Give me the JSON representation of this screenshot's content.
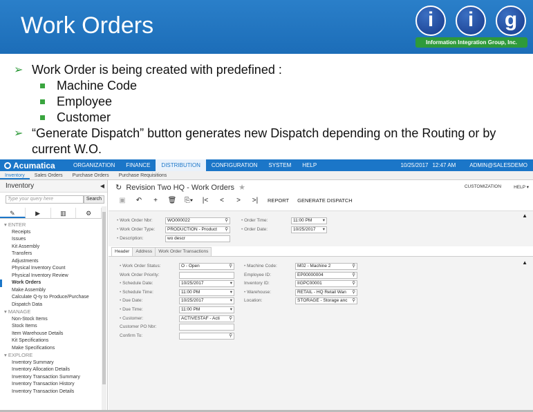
{
  "slide": {
    "title": "Work Orders",
    "logo": {
      "letters": [
        "i",
        "i",
        "g"
      ],
      "caption": "Information Integration Group, Inc."
    },
    "bullets": [
      {
        "level": 1,
        "text": "Work Order is being created with predefined :"
      },
      {
        "level": 2,
        "text": "Machine Code"
      },
      {
        "level": 2,
        "text": "Employee"
      },
      {
        "level": 2,
        "text": "Customer"
      },
      {
        "level": 1,
        "text": "“Generate Dispatch” button generates new Dispatch depending on the Routing or by current W.O."
      }
    ]
  },
  "app": {
    "brand": "Acumatica",
    "menu": [
      "ORGANIZATION",
      "FINANCE",
      "DISTRIBUTION",
      "CONFIGURATION",
      "SYSTEM",
      "HELP"
    ],
    "active_menu": "DISTRIBUTION",
    "date": "10/25/2017",
    "time": "12:47 AM",
    "user": "ADMIN@SALESDEMO",
    "subnav": [
      "Inventory",
      "Sales Orders",
      "Purchase Orders",
      "Purchase Requisitions"
    ],
    "sidebar": {
      "title": "Inventory",
      "search_placeholder": "Type your query here",
      "search_button": "Search",
      "sections": [
        {
          "name": "ENTER",
          "items": [
            "Receipts",
            "Issues",
            "Kit Assembly",
            "Transfers",
            "Adjustments",
            "Physical Inventory Count",
            "Physical Inventory Review",
            "Work Orders",
            "Make Assembly",
            "Calculate Q-ty to Produce/Purchase",
            "Dispatch Data"
          ]
        },
        {
          "name": "MANAGE",
          "items": [
            "Non-Stock Items",
            "Stock Items",
            "Item Warehouse Details",
            "Kit Specifications",
            "Make Specifications"
          ]
        },
        {
          "name": "EXPLORE",
          "items": [
            "Inventory Summary",
            "Inventory Allocation Details",
            "Inventory Transaction Summary",
            "Inventory Transaction History",
            "Inventory Transaction Details"
          ]
        }
      ],
      "active_item": "Work Orders"
    },
    "page": {
      "title": "Revision Two HQ - Work Orders",
      "customization": "CUSTOMIZATION",
      "help": "HELP ▾",
      "toolbar": {
        "report": "REPORT",
        "generate_dispatch": "GENERATE DISPATCH"
      },
      "header_fields": {
        "work_order_nbr": {
          "label": "Work Order Nbr:",
          "value": "WO000022"
        },
        "work_order_type": {
          "label": "Work Order Type:",
          "value": "PRODUCTION - Product"
        },
        "description": {
          "label": "Description:",
          "value": "wo descr"
        },
        "order_time": {
          "label": "Order Time:",
          "value": "11:00 PM"
        },
        "order_date": {
          "label": "Order Date:",
          "value": "10/25/2017"
        }
      },
      "tabs": [
        "Header",
        "Address",
        "Work Order Transactions"
      ],
      "active_tab": "Header",
      "detail_left": [
        {
          "label": "Work Order Status:",
          "value": "O - Open",
          "req": true,
          "icon": "search"
        },
        {
          "label": "Work Order Priority:",
          "value": "",
          "req": false,
          "icon": ""
        },
        {
          "label": "Schedule Date:",
          "value": "10/25/2017",
          "req": true,
          "icon": "dropdown"
        },
        {
          "label": "Schedule Time:",
          "value": "11:00 PM",
          "req": true,
          "icon": "dropdown"
        },
        {
          "label": "Due Date:",
          "value": "10/25/2017",
          "req": true,
          "icon": "dropdown"
        },
        {
          "label": "Due Time:",
          "value": "11:00 PM",
          "req": true,
          "icon": "dropdown"
        },
        {
          "label": "Customer:",
          "value": "ACTIVESTAF - Acti",
          "req": true,
          "icon": "search"
        },
        {
          "label": "Customer PO Nbr:",
          "value": "",
          "req": false,
          "icon": ""
        },
        {
          "label": "Confirm To:",
          "value": "",
          "req": false,
          "icon": "search"
        }
      ],
      "detail_right": [
        {
          "label": "Machine Code:",
          "value": "M02 - Machine 2",
          "req": true,
          "icon": "search"
        },
        {
          "label": "Employee ID:",
          "value": "EP00000004",
          "req": false,
          "icon": "search"
        },
        {
          "label": "Inventory ID:",
          "value": "IIGPC00001",
          "req": false,
          "icon": "search"
        },
        {
          "label": "Warehouse:",
          "value": "RETAIL - HQ Retail Wan",
          "req": true,
          "icon": "search"
        },
        {
          "label": "Location:",
          "value": "STORAGE - Storage anc",
          "req": false,
          "icon": "search"
        }
      ]
    }
  }
}
